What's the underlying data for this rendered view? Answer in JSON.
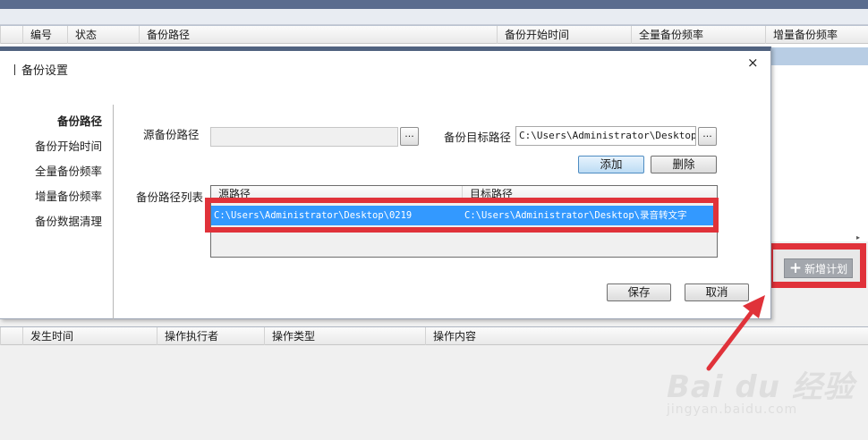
{
  "plan_table": {
    "columns": [
      "编号",
      "状态",
      "备份路径",
      "备份开始时间",
      "全量备份频率",
      "增量备份频率"
    ]
  },
  "add_plan_button": {
    "label": "新增计划"
  },
  "log_table": {
    "columns": [
      "发生时间",
      "操作执行者",
      "操作类型",
      "操作内容"
    ]
  },
  "dialog": {
    "title": "备份设置",
    "close_glyph": "×",
    "nav": [
      "备份路径",
      "备份开始时间",
      "全量备份频率",
      "增量备份频率",
      "备份数据清理"
    ],
    "source_label": "源备份路径",
    "source_value": "",
    "browse_glyph": "...",
    "target_label": "备份目标路径",
    "target_value": "C:\\Users\\Administrator\\Desktop\\录",
    "add_button": "添加",
    "delete_button": "删除",
    "list_label": "备份路径列表",
    "list_columns": [
      "源路径",
      "目标路径"
    ],
    "list_rows": [
      {
        "source": "C:\\Users\\Administrator\\Desktop\\0219",
        "target": "C:\\Users\\Administrator\\Desktop\\录音转文字"
      }
    ],
    "save_button": "保存",
    "cancel_button": "取消"
  },
  "watermark": {
    "main": "Bai du 经验",
    "sub": "jingyan.baidu.com"
  },
  "colors": {
    "highlight": "#e0323a",
    "selection": "#3399ff",
    "title_bar": "#50627f"
  }
}
